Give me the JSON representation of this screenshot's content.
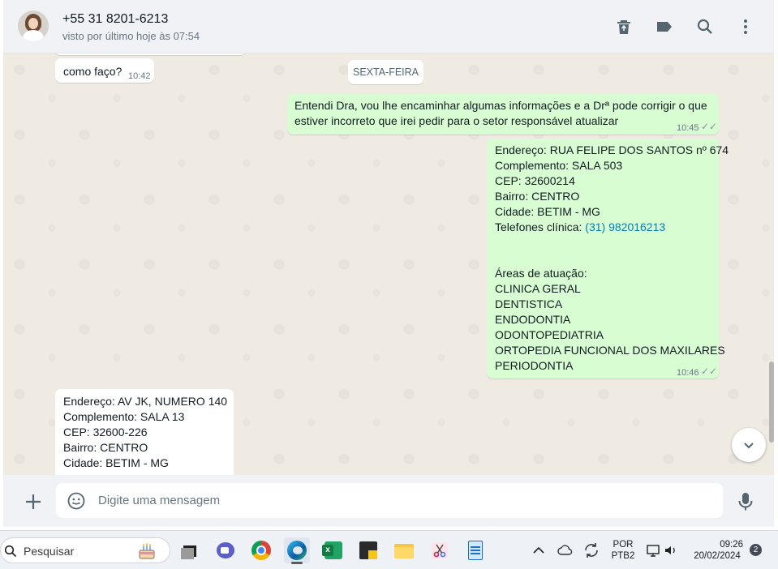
{
  "header": {
    "contact_name": "+55 31 8201-6213",
    "last_seen": "visto por último hoje às 07:54",
    "icons": [
      "delete-icon",
      "label-icon",
      "search-icon",
      "menu-icon"
    ]
  },
  "chat": {
    "prev_time_bubble_text": "como faço?",
    "prev_time": "10:42",
    "date_divider": "SEXTA-FEIRA",
    "messages": [
      {
        "dir": "out",
        "lines": [
          "Entendi Dra, vou lhe encaminhar algumas informações e a Drª pode corrigir o que",
          "estiver incorreto que irei pedir para o setor responsável atualizar"
        ],
        "time": "10:45"
      },
      {
        "dir": "out",
        "lines": [
          "Endereço: RUA FELIPE DOS SANTOS nº 674",
          "Complemento: SALA 503",
          "CEP: 32600214",
          "Bairro: CENTRO",
          "Cidade: BETIM - MG"
        ],
        "phone_label": "Telefones clínica: ",
        "phone": "(31) 982016213",
        "areas_title": "Áreas de atuação:",
        "areas": [
          "CLINICA GERAL",
          "DENTISTICA",
          "ENDODONTIA",
          "ODONTOPEDIATRIA",
          "ORTOPEDIA FUNCIONAL DOS MAXILARES",
          "PERIODONTIA"
        ],
        "time": "10:46"
      },
      {
        "dir": "in",
        "lines": [
          "Endereço: AV JK, NUMERO 140",
          "Complemento: SALA 13",
          "CEP: 32600-226",
          "Bairro: CENTRO",
          "Cidade: BETIM - MG"
        ]
      }
    ]
  },
  "composer": {
    "placeholder": "Digite uma mensagem"
  },
  "taskbar": {
    "search_placeholder": "Pesquisar",
    "apps": [
      "task-view",
      "teams",
      "chrome",
      "edge",
      "excel",
      "sticky-notes",
      "file-explorer",
      "snipping-tool",
      "notepad"
    ],
    "lang_top": "POR",
    "lang_bottom": "PTB2",
    "clock_time": "09:26",
    "clock_date": "20/02/2024",
    "notification_count": "2"
  },
  "colors": {
    "chat_bg": "#efeae2",
    "outgoing": "#d9fdd3",
    "incoming": "#ffffff",
    "header_bg": "#f0f2f5",
    "link": "#027eb5"
  }
}
